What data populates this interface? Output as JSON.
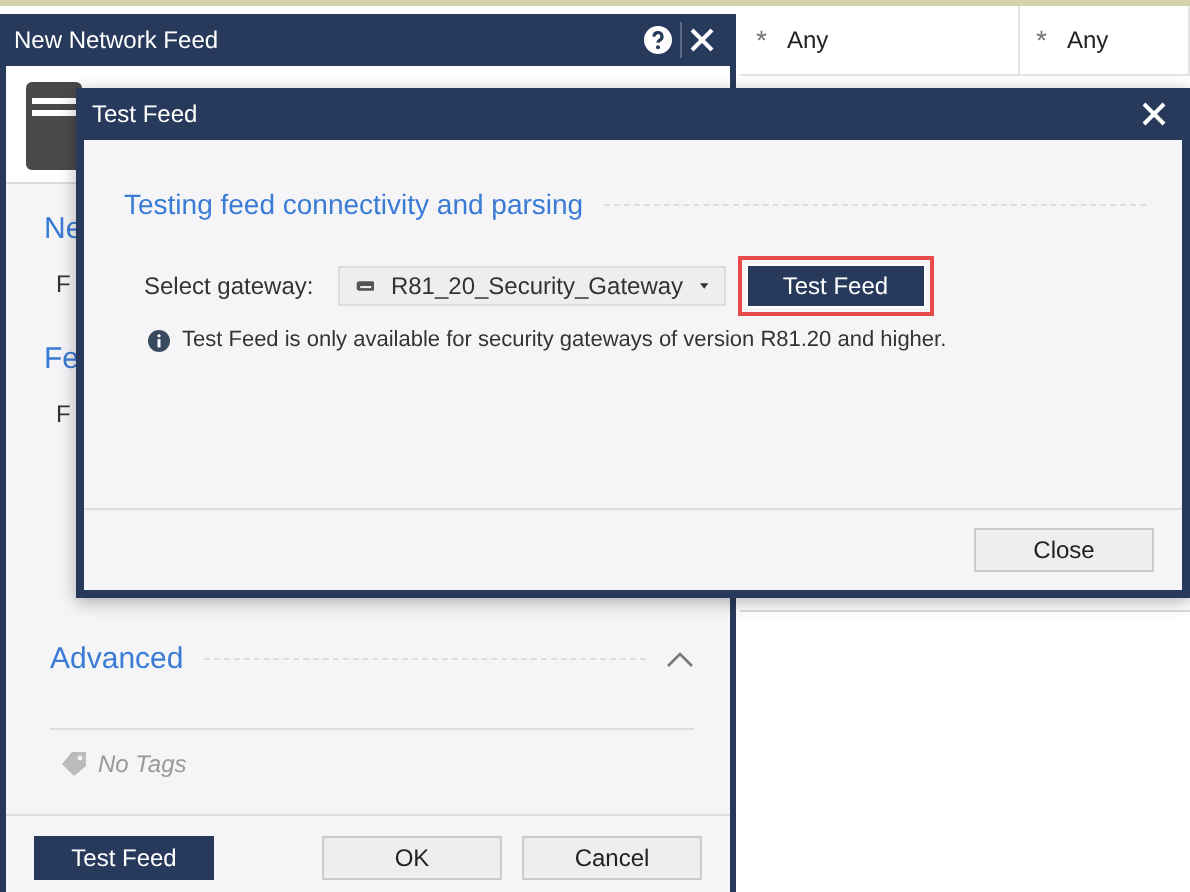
{
  "background_table": {
    "cells": [
      {
        "marker": "*",
        "text": "Any"
      },
      {
        "marker": "*",
        "text": "Any"
      }
    ]
  },
  "back_dialog": {
    "title": "New Network Feed",
    "sections": [
      {
        "heading": "Ne",
        "fields": [
          "F"
        ]
      },
      {
        "heading": "Fe",
        "fields": [
          "F"
        ]
      }
    ],
    "advanced": {
      "heading": "Advanced",
      "expanded": true
    },
    "tags": "No Tags",
    "buttons": [
      {
        "label": "Test Feed",
        "kind": "primary"
      },
      {
        "label": "OK",
        "kind": "secondary"
      },
      {
        "label": "Cancel",
        "kind": "secondary"
      }
    ]
  },
  "test_feed_dialog": {
    "title": "Test Feed",
    "heading": "Testing feed connectivity and parsing",
    "gateway": {
      "label": "Select gateway:",
      "value": "R81_20_Security_Gateway"
    },
    "test_button": {
      "label": "Test Feed",
      "highlighted": true
    },
    "info": "Test Feed is only available for security gateways of version R81.20 and higher.",
    "close_button": "Close"
  }
}
